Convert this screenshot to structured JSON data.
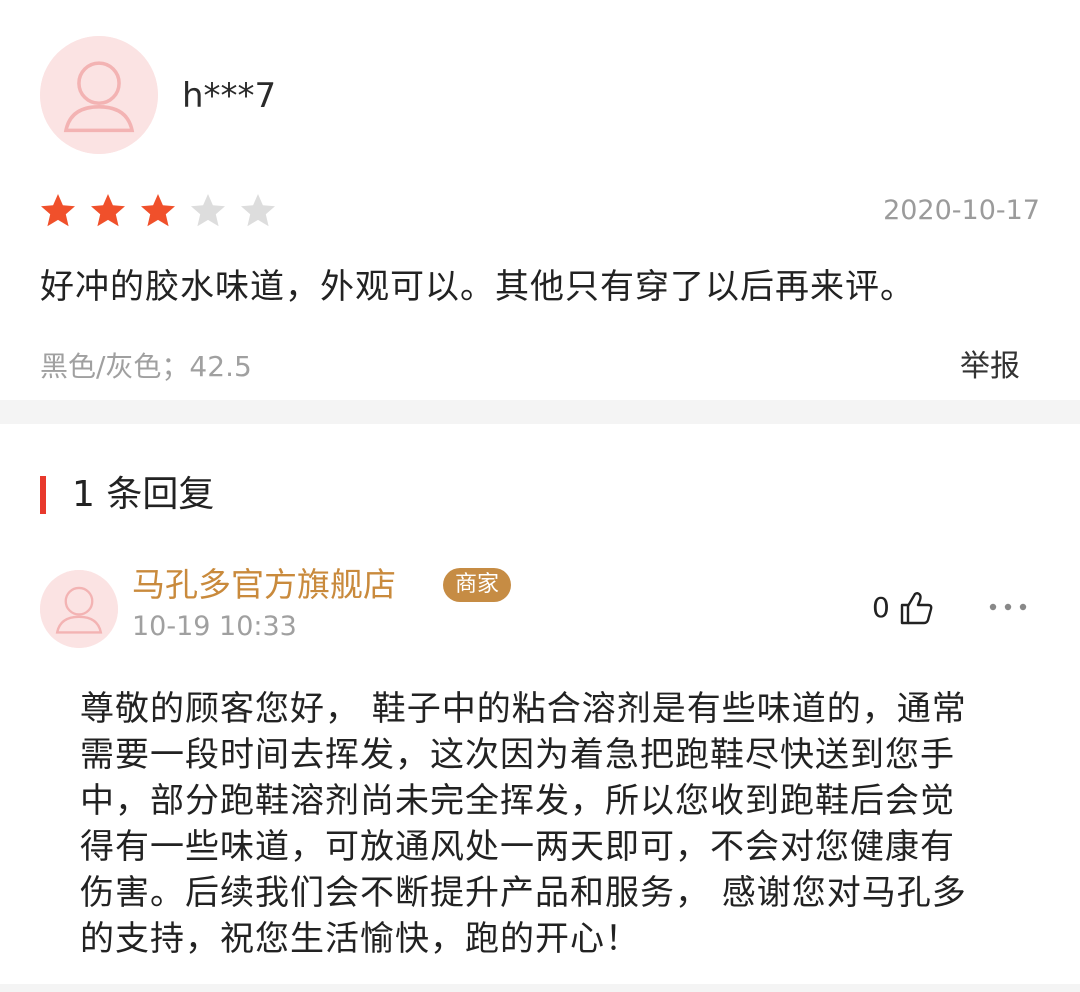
{
  "review": {
    "username": "h***7",
    "rating": 3,
    "max_rating": 5,
    "date": "2020-10-17",
    "text": "好冲的胶水味道，外观可以。其他只有穿了以后再来评。",
    "variant": "黑色/灰色；42.5",
    "report_label": "举报"
  },
  "replies_section": {
    "heading": "1 条回复"
  },
  "reply": {
    "shop_name": "马孔多官方旗舰店",
    "badge": "商家",
    "time": "10-19 10:33",
    "like_count": "0",
    "text_lines": [
      "尊敬的顾客您好， 鞋子中的粘合溶剂是有些味道的，通常",
      "需要一段时间去挥发，这次因为着急把跑鞋尽快送到您手",
      "中，部分跑鞋溶剂尚未完全挥发，所以您收到跑鞋后会觉",
      "得有一些味道，可放通风处一两天即可，不会对您健康有",
      "伤害。后续我们会不断提升产品和服务， 感谢您对马孔多",
      "的支持，祝您生活愉快，跑的开心！"
    ]
  },
  "colors": {
    "star_active": "#f0502b",
    "star_inactive": "#dddddd",
    "accent_red": "#e8392c",
    "shop_gold": "#c98a3c"
  },
  "icons": [
    "avatar-placeholder-icon",
    "star-icon",
    "thumbs-up-icon",
    "more-dots-icon"
  ]
}
